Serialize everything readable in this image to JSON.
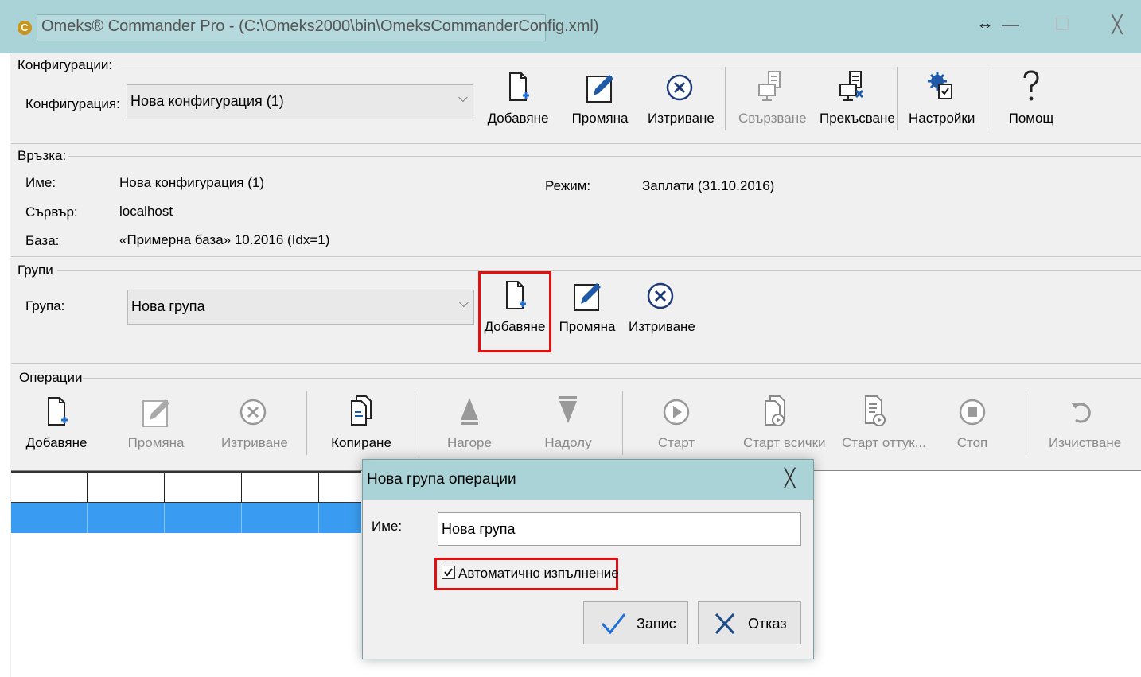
{
  "window": {
    "app_icon": "C",
    "title": "Omeks® Commander Pro - (C:\\Omeks2000\\bin\\OmeksCommanderConfig.xml)",
    "controls": {
      "resize_icon": "↔",
      "minimize_icon": "—",
      "maximize_icon": "☐",
      "close_icon": "╳"
    }
  },
  "config": {
    "section_label": "Конфигурации:",
    "field_label": "Конфигурация:",
    "selected": "Нова конфигурация (1)",
    "toolbar": [
      {
        "label": "Добавяне",
        "icon": "new-document-icon",
        "enabled": true
      },
      {
        "label": "Промяна",
        "icon": "edit-pencil-icon",
        "enabled": true
      },
      {
        "label": "Изтриване",
        "icon": "delete-x-icon",
        "enabled": true
      },
      {
        "label": "Свързване",
        "icon": "connect-computer-icon",
        "enabled": false
      },
      {
        "label": "Прекъсване",
        "icon": "disconnect-computer-icon",
        "enabled": true
      },
      {
        "label": "Настройки",
        "icon": "settings-gear-icon",
        "enabled": true
      },
      {
        "label": "Помощ",
        "icon": "help-question-icon",
        "enabled": true
      }
    ]
  },
  "connection": {
    "section_label": "Връзка:",
    "name_label": "Име:",
    "name_value": "Нова конфигурация (1)",
    "server_label": "Сървър:",
    "server_value": "localhost",
    "db_label": "База:",
    "db_value": "«Примерна база» 10.2016 (Idx=1)",
    "mode_label": "Режим:",
    "mode_value": "Заплати (31.10.2016)"
  },
  "groups": {
    "section_label": "Групи",
    "field_label": "Група:",
    "selected": "Нова група",
    "toolbar": [
      {
        "label": "Добавяне",
        "icon": "new-document-icon",
        "enabled": true,
        "highlighted": true
      },
      {
        "label": "Промяна",
        "icon": "edit-pencil-icon",
        "enabled": true
      },
      {
        "label": "Изтриване",
        "icon": "delete-x-icon",
        "enabled": true
      }
    ]
  },
  "operations": {
    "section_label": "Операции",
    "toolbar": [
      {
        "label": "Добавяне",
        "icon": "new-document-icon",
        "enabled": true
      },
      {
        "label": "Промяна",
        "icon": "edit-pencil-icon",
        "enabled": false
      },
      {
        "label": "Изтриване",
        "icon": "delete-x-icon",
        "enabled": false
      },
      {
        "label": "Копиране",
        "icon": "copy-documents-icon",
        "enabled": true
      },
      {
        "label": "Нагоре",
        "icon": "arrow-up-icon",
        "enabled": false
      },
      {
        "label": "Надолу",
        "icon": "arrow-down-icon",
        "enabled": false
      },
      {
        "label": "Старт",
        "icon": "play-icon",
        "enabled": false
      },
      {
        "label": "Старт всички",
        "icon": "play-all-icon",
        "enabled": false
      },
      {
        "label": "Старт оттук...",
        "icon": "play-from-here-icon",
        "enabled": false
      },
      {
        "label": "Стоп",
        "icon": "stop-icon",
        "enabled": false
      },
      {
        "label": "Изчистване",
        "icon": "clear-undo-icon",
        "enabled": false
      }
    ]
  },
  "dialog": {
    "title": "Нова група операции",
    "close_icon": "╳",
    "name_label": "Име:",
    "name_value": "Нова група",
    "auto_run_label": "Автоматично изпълнение",
    "auto_run_checked": true,
    "save_label": "Запис",
    "cancel_label": "Отказ"
  }
}
